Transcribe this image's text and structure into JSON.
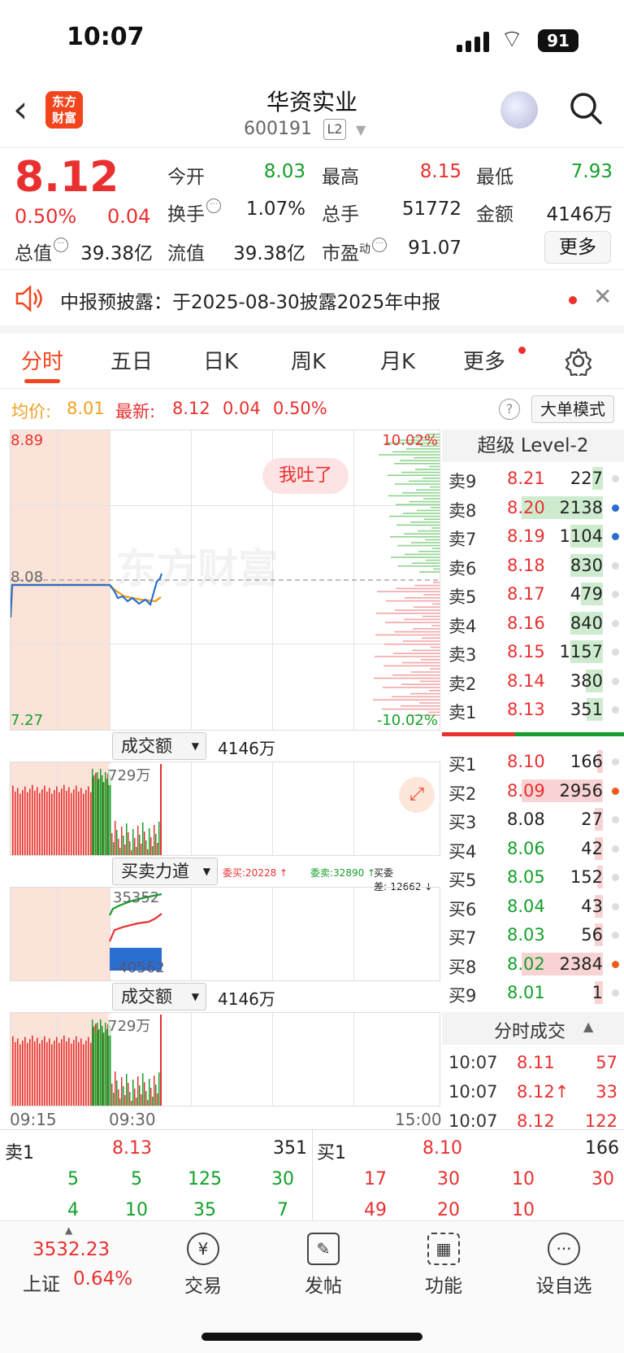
{
  "status": {
    "time": "10:07",
    "battery": "91"
  },
  "header": {
    "logo": "东方财富",
    "title": "华资实业",
    "code": "600191",
    "level": "L2"
  },
  "quote": {
    "price": "8.12",
    "pct": "0.50%",
    "change": "0.04",
    "open_label": "今开",
    "open": "8.03",
    "high_label": "最高",
    "high": "8.15",
    "low_label": "最低",
    "low": "7.93",
    "turnover_label": "换手",
    "turnover": "1.07%",
    "volume_label": "总手",
    "volume": "51772",
    "amount_label": "金额",
    "amount": "4146万",
    "mktcap_label": "总值",
    "mktcap": "39.38亿",
    "float_label": "流值",
    "float": "39.38亿",
    "pe_label": "市盈",
    "pe_sup": "动",
    "pe": "91.07",
    "more": "更多"
  },
  "notice": {
    "text": "中报预披露：于2025-08-30披露2025年中报"
  },
  "tabs": [
    "分时",
    "五日",
    "日K",
    "周K",
    "月K",
    "更多"
  ],
  "info": {
    "avg_label": "均价:",
    "avg": "8.01",
    "last_label": "最新:",
    "last": "8.12",
    "chg": "0.04",
    "pct": "0.50%",
    "mode": "大单模式"
  },
  "chart": {
    "y_high": "8.89",
    "y_mid": "8.08",
    "y_low": "7.27",
    "pct_high": "10.02%",
    "pct_low": "-10.02%",
    "bubble": "我吐了",
    "watermark": "东方财富"
  },
  "sub1": {
    "selector": "成交额",
    "total": "4146万",
    "peak": "729万"
  },
  "sub2": {
    "selector": "买卖力道",
    "buy": "委买:20228 ↑",
    "sell": "委卖:32890 ↑",
    "diff": "买委差:-12662 ↓",
    "top": "35352",
    "bottom": "-40562"
  },
  "sub3": {
    "selector": "成交额",
    "total": "4146万",
    "peak": "729万"
  },
  "time_axis": {
    "start": "09:15",
    "open": "09:30",
    "end": "15:00"
  },
  "book": {
    "title": "超级 Level-2",
    "asks": [
      {
        "label": "卖9",
        "price": "8.21",
        "qty": "227"
      },
      {
        "label": "卖8",
        "price": "8.20",
        "qty": "2138"
      },
      {
        "label": "卖7",
        "price": "8.19",
        "qty": "1104"
      },
      {
        "label": "卖6",
        "price": "8.18",
        "qty": "830"
      },
      {
        "label": "卖5",
        "price": "8.17",
        "qty": "479"
      },
      {
        "label": "卖4",
        "price": "8.16",
        "qty": "840"
      },
      {
        "label": "卖3",
        "price": "8.15",
        "qty": "1157"
      },
      {
        "label": "卖2",
        "price": "8.14",
        "qty": "380"
      },
      {
        "label": "卖1",
        "price": "8.13",
        "qty": "351"
      }
    ],
    "bids": [
      {
        "label": "买1",
        "price": "8.10",
        "qty": "166"
      },
      {
        "label": "买2",
        "price": "8.09",
        "qty": "2956"
      },
      {
        "label": "买3",
        "price": "8.08",
        "qty": "27"
      },
      {
        "label": "买4",
        "price": "8.06",
        "qty": "42"
      },
      {
        "label": "买5",
        "price": "8.05",
        "qty": "152"
      },
      {
        "label": "买6",
        "price": "8.04",
        "qty": "43"
      },
      {
        "label": "买7",
        "price": "8.03",
        "qty": "56"
      },
      {
        "label": "买8",
        "price": "8.02",
        "qty": "2384"
      },
      {
        "label": "买9",
        "price": "8.01",
        "qty": "1"
      }
    ],
    "trades_title": "分时成交",
    "trades": [
      {
        "time": "10:07",
        "price": "8.11",
        "vol": "57"
      },
      {
        "time": "10:07",
        "price": "8.12↑",
        "vol": "33"
      },
      {
        "time": "10:07",
        "price": "8.12",
        "vol": "122"
      }
    ]
  },
  "level1": {
    "ask_label": "卖1",
    "ask_price": "8.13",
    "ask_qty": "351",
    "bid_label": "买1",
    "bid_price": "8.10",
    "bid_qty": "166",
    "ask_row1": [
      "5",
      "5",
      "125",
      "30"
    ],
    "ask_row2": [
      "4",
      "10",
      "35",
      "7"
    ],
    "bid_row1": [
      "17",
      "30",
      "10",
      "30"
    ],
    "bid_row2": [
      "49",
      "20",
      "10"
    ]
  },
  "nav": {
    "index_value": "3532.23",
    "index_name": "上证",
    "index_pct": "0.64%",
    "items": [
      "交易",
      "发帖",
      "功能",
      "设自选"
    ]
  }
}
